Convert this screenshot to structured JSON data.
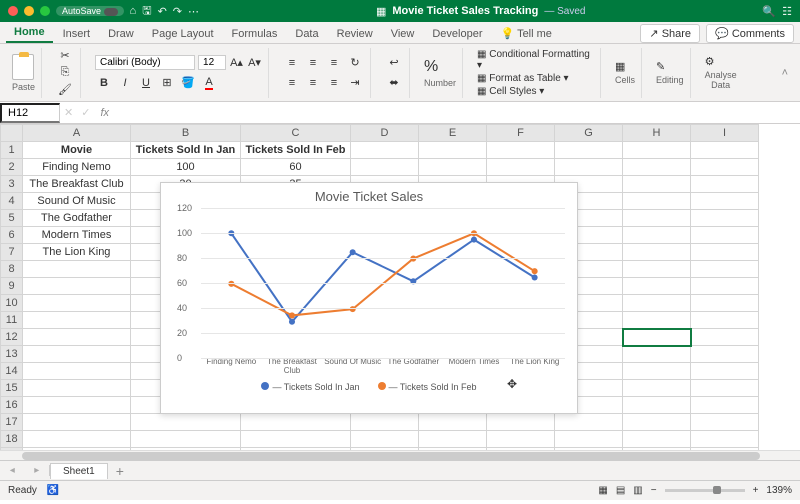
{
  "titlebar": {
    "autosave": "AutoSave",
    "filename": "Movie Ticket Sales Tracking",
    "state": "— Saved"
  },
  "tabs": [
    "Home",
    "Insert",
    "Draw",
    "Page Layout",
    "Formulas",
    "Data",
    "Review",
    "View",
    "Developer"
  ],
  "tellme": "Tell me",
  "share": "Share",
  "comments": "Comments",
  "ribbon": {
    "paste": "Paste",
    "font": "Calibri (Body)",
    "size": "12",
    "number_label": "Number",
    "cond_fmt": "Conditional Formatting",
    "fmt_table": "Format as Table",
    "cell_styles": "Cell Styles",
    "cells": "Cells",
    "editing": "Editing",
    "analyse": "Analyse\nData"
  },
  "namebox": "H12",
  "columns": [
    "A",
    "B",
    "C",
    "D",
    "E",
    "F",
    "G",
    "H",
    "I"
  ],
  "rows": [
    {
      "n": 1,
      "a": "Movie",
      "b": "Tickets Sold In Jan",
      "c": "Tickets Sold In Feb",
      "bold": true
    },
    {
      "n": 2,
      "a": "Finding Nemo",
      "b": "100",
      "c": "60"
    },
    {
      "n": 3,
      "a": "The Breakfast Club",
      "b": "30",
      "c": "35"
    },
    {
      "n": 4,
      "a": "Sound Of Music",
      "b": "",
      "c": ""
    },
    {
      "n": 5,
      "a": "The Godfather",
      "b": "",
      "c": ""
    },
    {
      "n": 6,
      "a": "Modern Times",
      "b": "",
      "c": ""
    },
    {
      "n": 7,
      "a": "The Lion King",
      "b": "",
      "c": ""
    }
  ],
  "chart_data": {
    "type": "line",
    "title": "Movie Ticket Sales",
    "categories": [
      "Finding Nemo",
      "The Breakfast Club",
      "Sound Of Music",
      "The Godfather",
      "Modern Times",
      "The Lion King"
    ],
    "series": [
      {
        "name": "Tickets Sold In Jan",
        "color": "#4472c4",
        "values": [
          100,
          30,
          85,
          62,
          95,
          65
        ]
      },
      {
        "name": "Tickets Sold In Feb",
        "color": "#ed7d31",
        "values": [
          60,
          35,
          40,
          80,
          100,
          70
        ]
      }
    ],
    "yticks": [
      0,
      20,
      40,
      60,
      80,
      100,
      120
    ],
    "ylim": [
      0,
      120
    ]
  },
  "sheet_tab": "Sheet1",
  "status": {
    "ready": "Ready",
    "zoom": "139%"
  }
}
